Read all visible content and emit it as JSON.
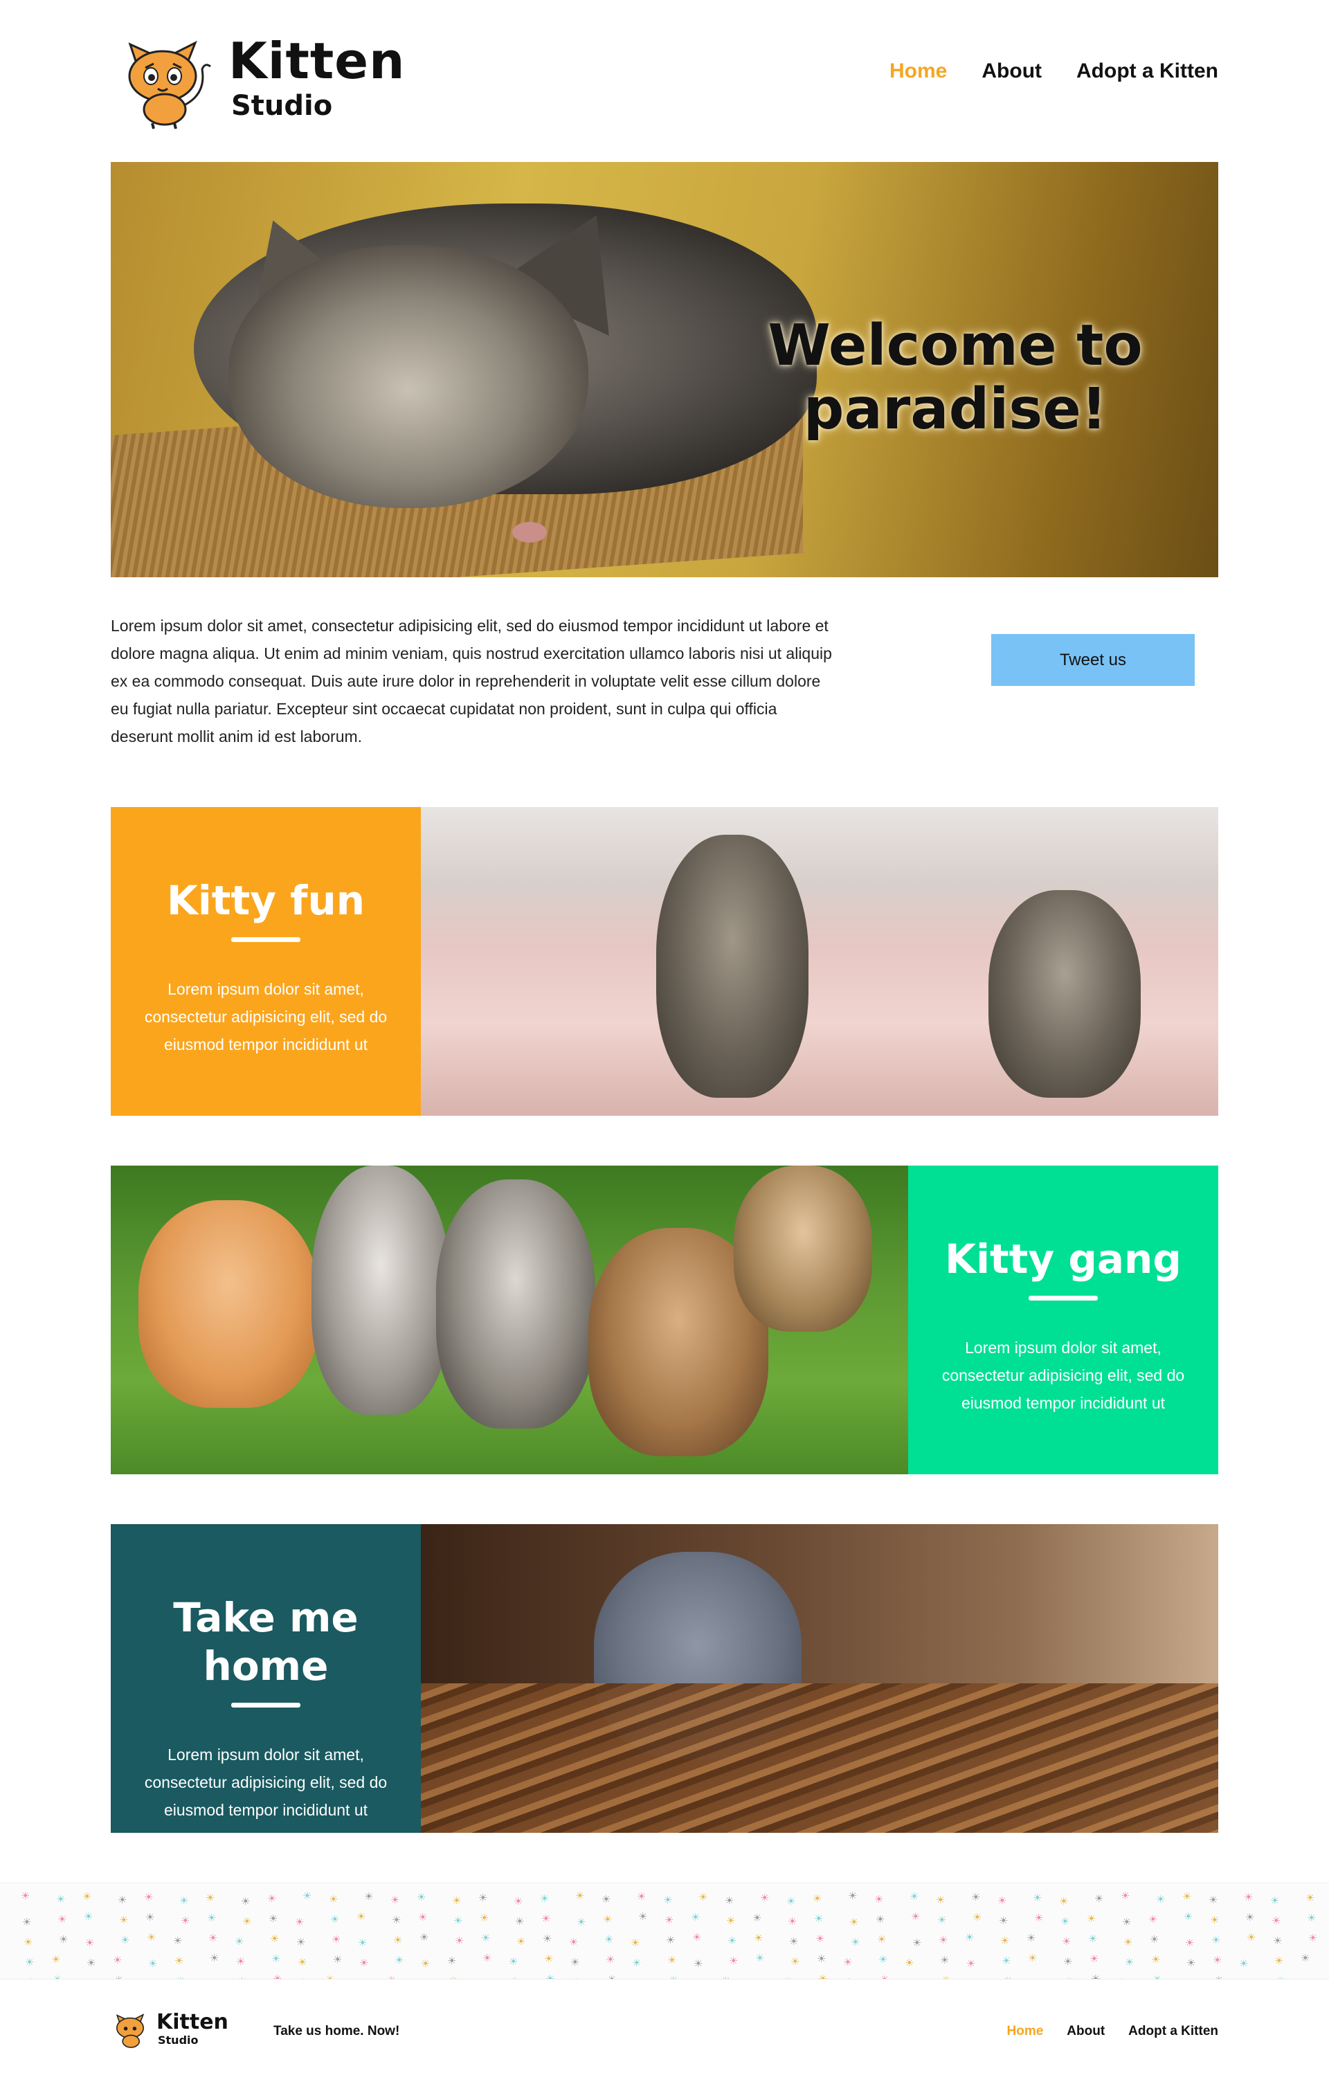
{
  "header": {
    "logo_line1": "Kitten",
    "logo_line2": "Studio",
    "nav": [
      {
        "label": "Home",
        "active": true
      },
      {
        "label": "About",
        "active": false
      },
      {
        "label": "Adopt a Kitten",
        "active": false
      }
    ]
  },
  "hero": {
    "title": "Welcome to paradise!"
  },
  "intro": {
    "text": "Lorem ipsum dolor sit amet, consectetur adipisicing elit, sed do eiusmod tempor incididunt ut labore et dolore magna aliqua. Ut enim ad minim veniam, quis nostrud exercitation ullamco laboris nisi ut aliquip ex ea commodo consequat. Duis aute irure dolor in reprehenderit in voluptate velit esse cillum dolore eu fugiat nulla pariatur. Excepteur sint occaecat cupidatat non proident, sunt in culpa qui officia deserunt mollit anim id est laborum.",
    "tweet_label": "Tweet us"
  },
  "features": [
    {
      "title": "Kitty fun",
      "text": "Lorem ipsum dolor sit amet, consectetur adipisicing elit, sed do eiusmod tempor incididunt ut",
      "color": "#fba51d"
    },
    {
      "title": "Kitty gang",
      "text": "Lorem ipsum dolor sit amet, consectetur adipisicing elit, sed do eiusmod tempor incididunt ut",
      "color": "#00e094"
    },
    {
      "title": "Take me home",
      "text": "Lorem ipsum dolor sit amet, consectetur adipisicing elit, sed do eiusmod tempor incididunt ut",
      "color": "#1a5a60"
    }
  ],
  "footer": {
    "logo_line1": "Kitten",
    "logo_line2": "Studio",
    "tagline": "Take us home. Now!",
    "nav": [
      {
        "label": "Home",
        "active": true
      },
      {
        "label": "About",
        "active": false
      },
      {
        "label": "Adopt a Kitten",
        "active": false
      }
    ]
  },
  "colors": {
    "accent": "#f5a623",
    "tweet_button": "#79c2f5",
    "paw_colors": [
      "#f08aa0",
      "#7fd1d6",
      "#e6b84a",
      "#9a9a9a"
    ]
  }
}
